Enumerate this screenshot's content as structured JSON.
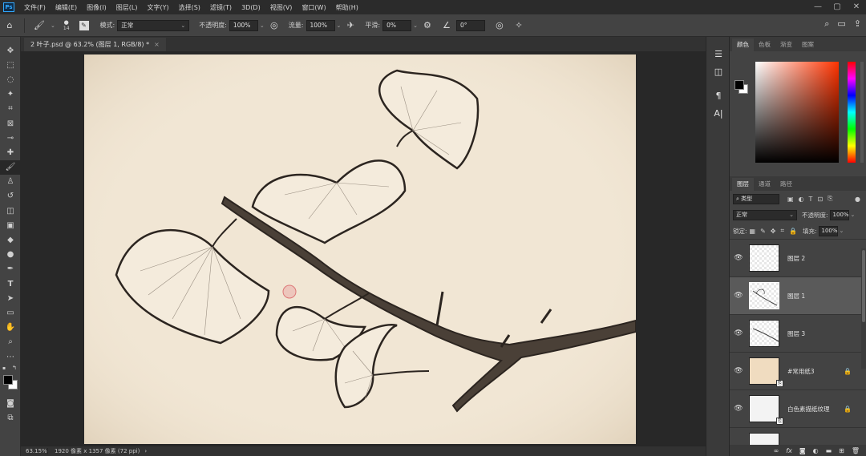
{
  "app": {
    "logo": "Ps"
  },
  "menu": [
    "文件(F)",
    "编辑(E)",
    "图像(I)",
    "图层(L)",
    "文字(Y)",
    "选择(S)",
    "滤镜(T)",
    "3D(D)",
    "视图(V)",
    "窗口(W)",
    "帮助(H)"
  ],
  "window_controls": {
    "minimize": "—",
    "maximize": "▢",
    "close": "✕"
  },
  "options": {
    "brush_size": "14",
    "mode_label": "模式:",
    "mode_value": "正常",
    "opacity_label": "不透明度:",
    "opacity_value": "100%",
    "flow_label": "流量:",
    "flow_value": "100%",
    "smooth_label": "平滑:",
    "smooth_value": "0%",
    "angle_value": "0°"
  },
  "document": {
    "tab_title": "2 叶子.psd @ 63.2% (图层 1, RGB/8) *",
    "close": "×"
  },
  "status": {
    "zoom": "63.15%",
    "info": "1920 像素 x 1357 像素 (72 ppi)",
    "arrow": "›"
  },
  "color_panel": {
    "tabs": [
      "颜色",
      "色板",
      "渐变",
      "图案"
    ],
    "active_tab": 0,
    "colors": {
      "foreground": "#000000",
      "background": "#ffffff",
      "hue": "#ff3300"
    }
  },
  "layers_panel": {
    "tabs": [
      "图层",
      "通道",
      "路径"
    ],
    "active_tab": 0,
    "filter_kind": "类型",
    "blend_mode": "正常",
    "opacity_label": "不透明度:",
    "opacity_value": "100%",
    "lock_label": "锁定:",
    "fill_label": "填充:",
    "fill_value": "100%",
    "layers": [
      {
        "name": "图层 2",
        "thumb": "checker",
        "selected": false,
        "locked": false,
        "linked": false
      },
      {
        "name": "图层 1",
        "thumb": "checker",
        "selected": true,
        "locked": false,
        "linked": false
      },
      {
        "name": "图层 3",
        "thumb": "checker",
        "selected": false,
        "locked": false,
        "linked": false
      },
      {
        "name": "#常用纸3",
        "thumb": "paper",
        "selected": false,
        "locked": true,
        "linked": true
      },
      {
        "name": "白色素描纸纹理",
        "thumb": "white",
        "selected": false,
        "locked": true,
        "linked": true
      }
    ]
  }
}
